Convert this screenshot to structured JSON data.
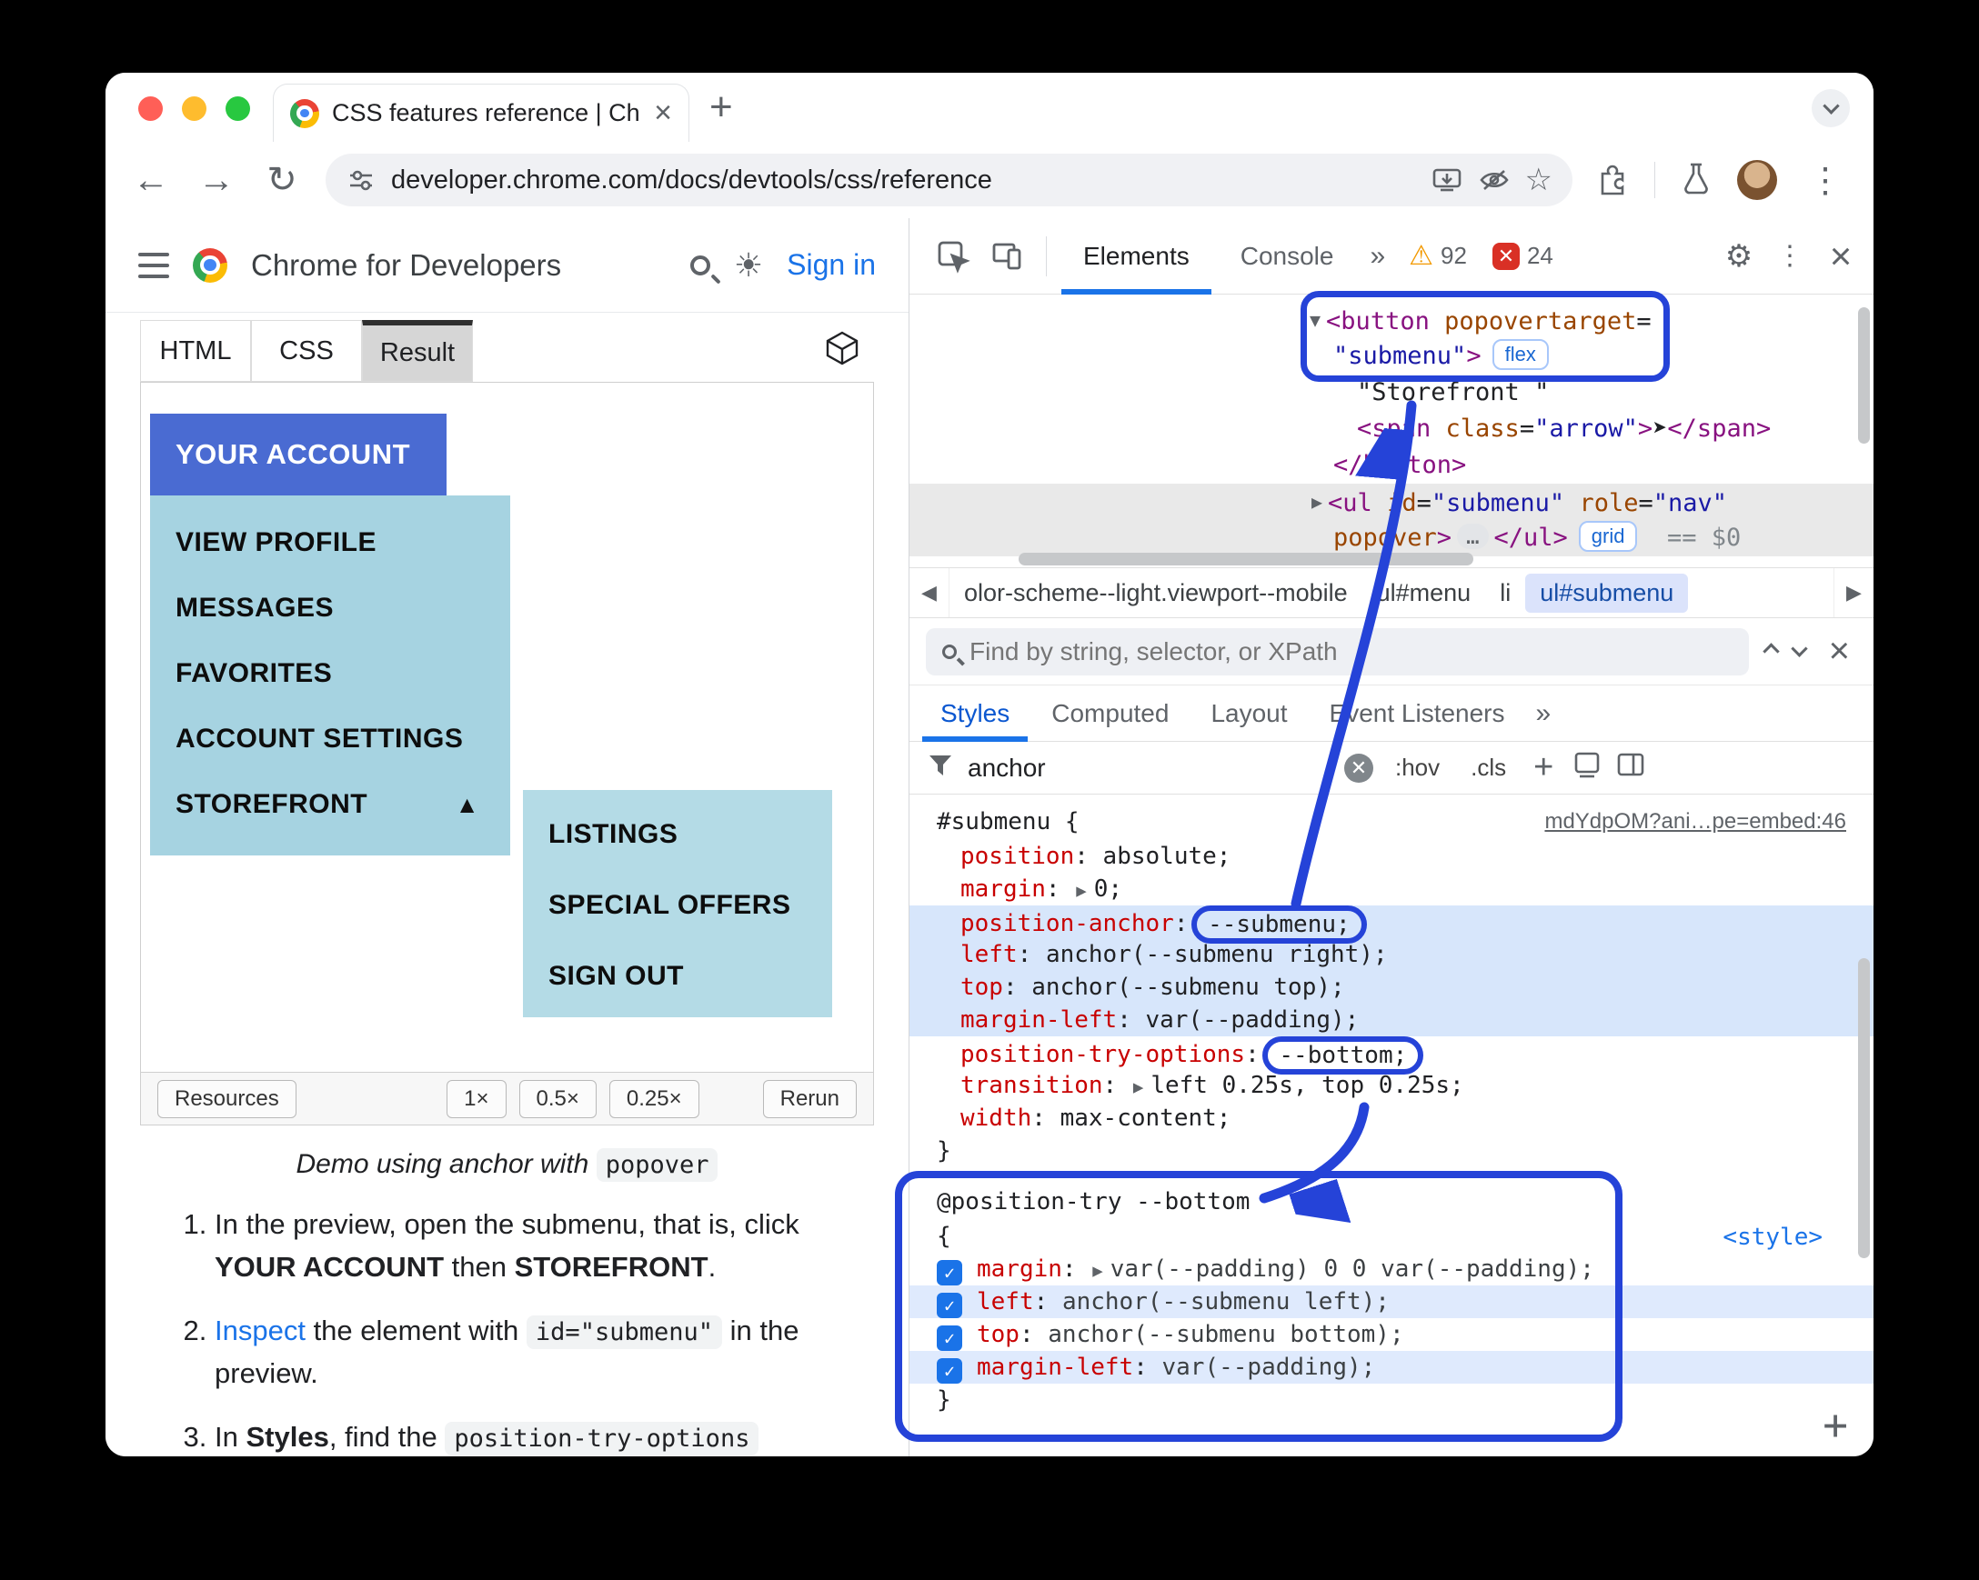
{
  "browser": {
    "tab_title": "CSS features reference  |  Chr",
    "url": "developer.chrome.com/docs/devtools/css/reference",
    "new_tab": "+"
  },
  "doc": {
    "brand": "Chrome for Developers",
    "sign_in": "Sign in",
    "tabs": [
      "HTML",
      "CSS",
      "Result"
    ],
    "demo": {
      "account": "YOUR ACCOUNT",
      "menu": [
        "VIEW PROFILE",
        "MESSAGES",
        "FAVORITES",
        "ACCOUNT SETTINGS"
      ],
      "storefront": "STOREFRONT",
      "storefront_arrow": "▲",
      "submenu": [
        "LISTINGS",
        "SPECIAL OFFERS",
        "SIGN OUT"
      ]
    },
    "resources": {
      "label": "Resources",
      "zoom": [
        "1×",
        "0.5×",
        "0.25×"
      ],
      "rerun": "Rerun"
    },
    "caption": [
      {
        "t": "it",
        "x": "Demo using anchor with "
      },
      {
        "t": "code",
        "x": "popover"
      }
    ],
    "steps": [
      [
        {
          "t": "text",
          "x": "In the preview, open the submenu, that is, click "
        },
        {
          "t": "b",
          "x": "YOUR ACCOUNT"
        },
        {
          "t": "text",
          "x": " then "
        },
        {
          "t": "b",
          "x": "STOREFRONT"
        },
        {
          "t": "text",
          "x": "."
        }
      ],
      [
        {
          "t": "link",
          "x": "Inspect"
        },
        {
          "t": "text",
          "x": " the element with "
        },
        {
          "t": "code",
          "x": "id=\"submenu\""
        },
        {
          "t": "text",
          "x": " in the preview."
        }
      ],
      [
        {
          "t": "text",
          "x": "In "
        },
        {
          "t": "b",
          "x": "Styles"
        },
        {
          "t": "text",
          "x": ", find the "
        },
        {
          "t": "code",
          "x": "position-try-options"
        }
      ]
    ]
  },
  "devtools": {
    "toolbar": {
      "tab_elements": "Elements",
      "tab_console": "Console",
      "warnings": "92",
      "errors": "24"
    },
    "elements": {
      "lines": [
        [
          {
            "t": "arrow",
            "x": "▼"
          },
          {
            "t": "tag",
            "x": "<button"
          },
          {
            "t": "attr",
            "x": " popovertarget"
          },
          {
            "t": "punct",
            "x": "="
          }
        ],
        [
          {
            "t": "val",
            "x": "\"submenu\""
          },
          {
            "t": "tag",
            "x": ">"
          },
          {
            "t": "badge",
            "x": "flex"
          }
        ],
        [
          {
            "t": "text",
            "x": "\"Storefront \""
          }
        ],
        [
          {
            "t": "tag",
            "x": "<span"
          },
          {
            "t": "attr",
            "x": " class"
          },
          {
            "t": "punct",
            "x": "="
          },
          {
            "t": "val",
            "x": "\"arrow\""
          },
          {
            "t": "tag",
            "x": ">"
          },
          {
            "t": "text",
            "x": "➤"
          },
          {
            "t": "tag",
            "x": "</span>"
          }
        ],
        [
          {
            "t": "tag",
            "x": "</button>"
          }
        ],
        [
          {
            "t": "arrow",
            "x": "▶"
          },
          {
            "t": "tag",
            "x": "<ul"
          },
          {
            "t": "attr",
            "x": " id"
          },
          {
            "t": "punct",
            "x": "="
          },
          {
            "t": "val",
            "x": "\"submenu\""
          },
          {
            "t": "attr",
            "x": " role"
          },
          {
            "t": "punct",
            "x": "="
          },
          {
            "t": "val",
            "x": "\"nav\""
          }
        ],
        [
          {
            "t": "attr",
            "x": "popover"
          },
          {
            "t": "tag",
            "x": ">"
          },
          {
            "t": "dots",
            "x": "…"
          },
          {
            "t": "tag",
            "x": "</ul>"
          },
          {
            "t": "badge",
            "x": "grid"
          },
          {
            "t": "eq",
            "x": "  == "
          },
          {
            "t": "dollar",
            "x": "$0"
          }
        ]
      ]
    },
    "crumbs": [
      "olor-scheme--light.viewport--mobile",
      "ul#menu",
      "li",
      "ul#submenu"
    ],
    "find_placeholder": "Find by string, selector, or XPath",
    "side_tabs": [
      "Styles",
      "Computed",
      "Layout",
      "Event Listeners"
    ],
    "filter": {
      "value": "anchor",
      "hov": ":hov",
      "cls": ".cls"
    },
    "rule": {
      "selector": "#submenu {",
      "source_link": "mdYdpOM?ani…pe=embed:46",
      "close": "}",
      "props": [
        {
          "name": "position",
          "value": "absolute;"
        },
        {
          "name": "margin",
          "value": "0;"
        },
        {
          "name": "position-anchor",
          "value": "--submenu;"
        },
        {
          "name": "left",
          "value": "anchor(--submenu right);"
        },
        {
          "name": "top",
          "value": "anchor(--submenu top);"
        },
        {
          "name": "margin-left",
          "value": "var(--padding);"
        },
        {
          "name": "position-try-options",
          "value": "--bottom;"
        },
        {
          "name": "transition",
          "value": "left 0.25s, top 0.25s;"
        },
        {
          "name": "width",
          "value": "max-content;"
        }
      ]
    },
    "position_try": {
      "header": "@position-try --bottom",
      "style_link": "<style>",
      "open": "{",
      "close": "}",
      "props": [
        {
          "name": "margin",
          "value": "var(--padding) 0 0 var(--padding);"
        },
        {
          "name": "left",
          "value": "anchor(--submenu left);"
        },
        {
          "name": "top",
          "value": "anchor(--submenu bottom);"
        },
        {
          "name": "margin-left",
          "value": "var(--padding);"
        }
      ]
    }
  }
}
